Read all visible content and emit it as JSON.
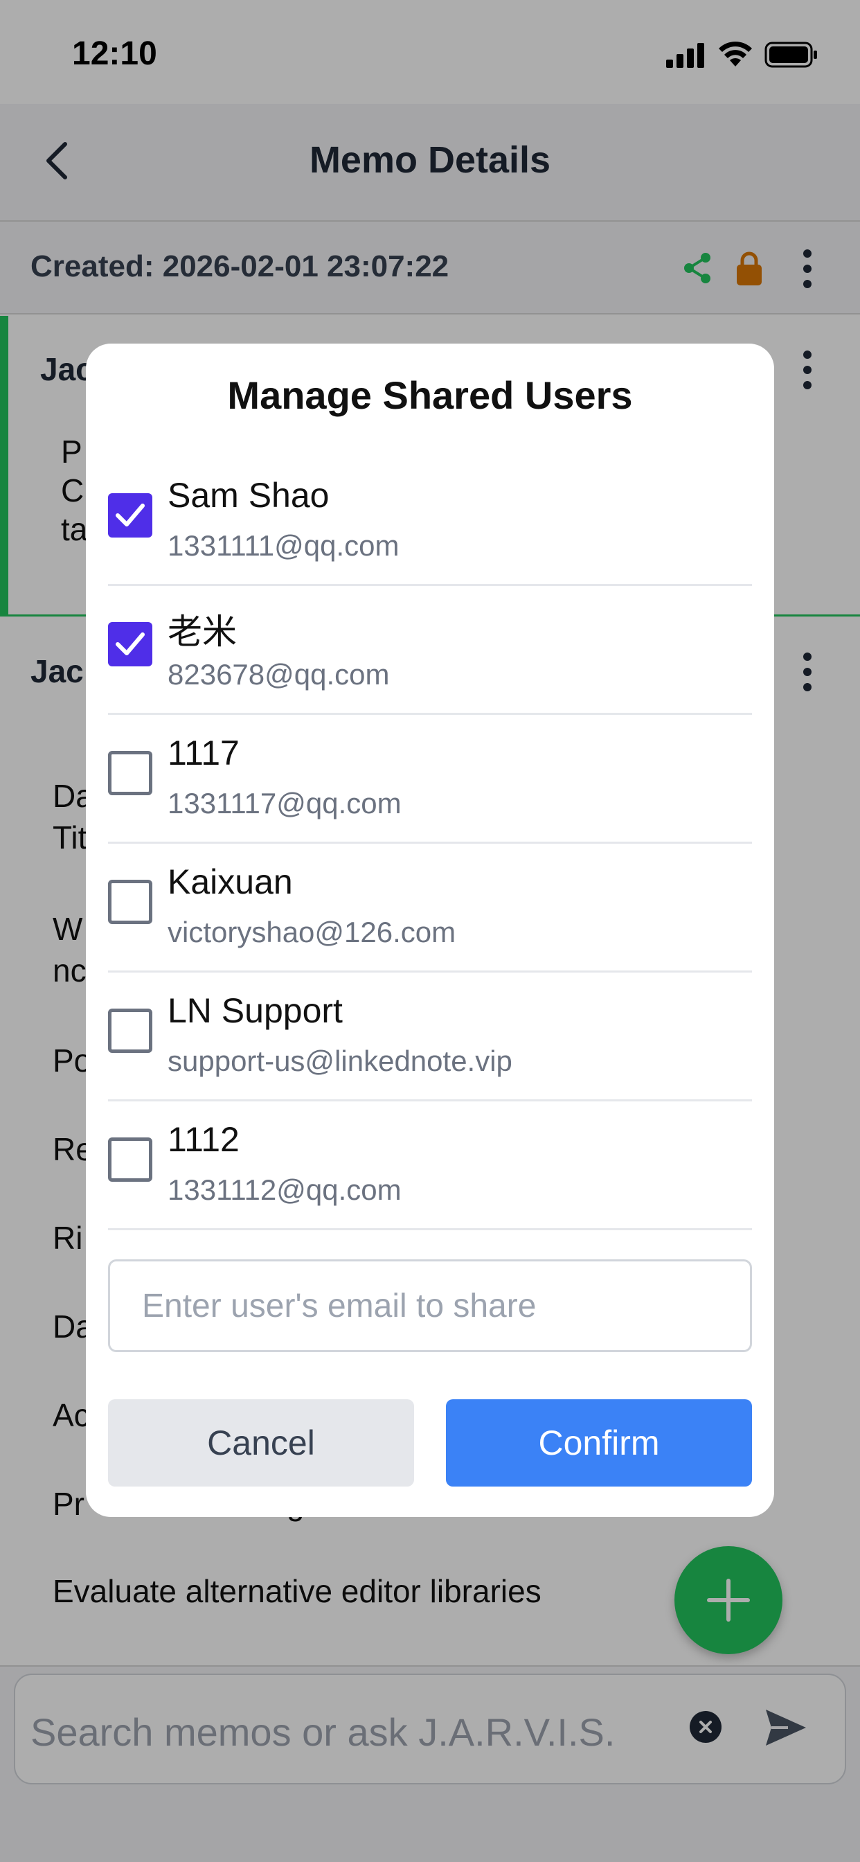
{
  "status_bar": {
    "time": "12:10"
  },
  "header": {
    "title": "Memo Details"
  },
  "memo_meta": {
    "created": "Created: 2026-02-01 23:07:22"
  },
  "memo1": {
    "author": "Jac",
    "body_lines": [
      "P",
      "C",
      "ta"
    ]
  },
  "memo2": {
    "author": "Jac",
    "items": [
      "Da",
      "Tit",
      "W",
      "nc",
      "Po",
      "Re",
      "Ri",
      "Da",
      "Ac",
      "Pr",
      "g",
      "Evaluate alternative editor libraries"
    ]
  },
  "search": {
    "placeholder": "Search memos or ask J.A.R.V.I.S."
  },
  "modal": {
    "title": "Manage Shared Users",
    "users": [
      {
        "name": "Sam Shao",
        "email": "1331111@qq.com",
        "checked": true
      },
      {
        "name": "老米",
        "email": "823678@qq.com",
        "checked": true
      },
      {
        "name": "1117",
        "email": "1331117@qq.com",
        "checked": false
      },
      {
        "name": "Kaixuan",
        "email": "victoryshao@126.com",
        "checked": false
      },
      {
        "name": "LN Support",
        "email": "support-us@linkednote.vip",
        "checked": false
      },
      {
        "name": "1112",
        "email": "1331112@qq.com",
        "checked": false
      }
    ],
    "email_placeholder": "Enter user's email to share",
    "cancel_label": "Cancel",
    "confirm_label": "Confirm"
  },
  "colors": {
    "accent_green": "#22c55e",
    "lock_orange": "#d97706",
    "checkbox_purple": "#4f2ee8",
    "confirm_blue": "#3b82f6"
  }
}
